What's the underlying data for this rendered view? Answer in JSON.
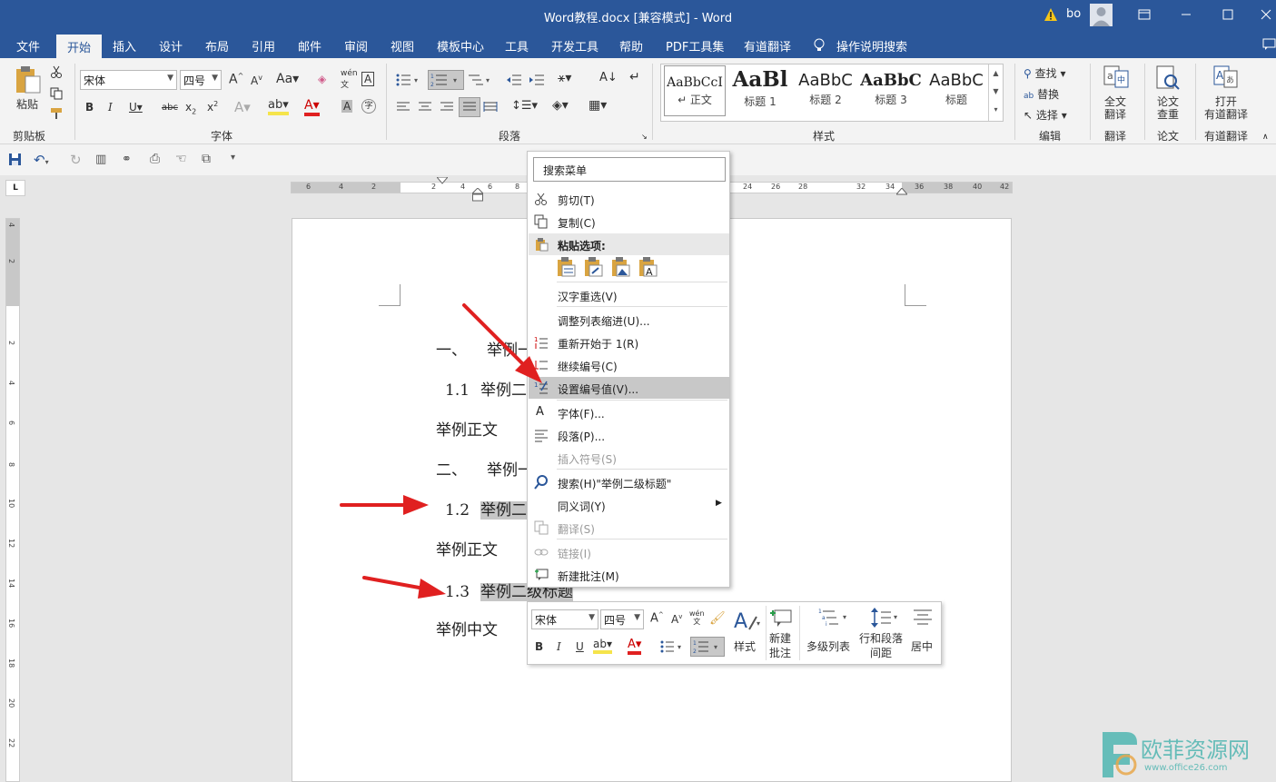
{
  "window": {
    "title": "Word教程.docx [兼容模式]  -  Word",
    "user": "bo"
  },
  "menu_tabs": [
    "文件",
    "开始",
    "插入",
    "设计",
    "布局",
    "引用",
    "邮件",
    "审阅",
    "视图",
    "模板中心",
    "工具",
    "开发工具",
    "帮助",
    "PDF工具集",
    "有道翻译"
  ],
  "tell_me": "操作说明搜索",
  "ribbon": {
    "paste_label": "粘贴",
    "clipboard_label": "剪贴板",
    "font_name": "宋体",
    "font_size": "四号",
    "font_label": "字体",
    "paragraph_label": "段落",
    "styles_label": "样式",
    "styles": [
      {
        "preview": "AaBbCcI",
        "name": "↵ 正文"
      },
      {
        "preview": "AaBl",
        "name": "标题 1"
      },
      {
        "preview": "AaBbC",
        "name": "标题 2"
      },
      {
        "preview": "AaBbC",
        "name": "标题 3"
      },
      {
        "preview": "AaBbC",
        "name": "标题"
      }
    ],
    "find": "查找",
    "replace": "替换",
    "select": "选择",
    "edit_label": "编辑",
    "full_translate": [
      "全文",
      "翻译"
    ],
    "translate_label": "翻译",
    "paper_check": [
      "论文",
      "查重"
    ],
    "paper_label": "论文",
    "open_youdao": [
      "打开",
      "有道翻译"
    ],
    "youdao_label": "有道翻译"
  },
  "ruler_numbers": [
    "6",
    "4",
    "2",
    "2",
    "4",
    "6",
    "8",
    "24",
    "26",
    "28",
    "32",
    "34",
    "36",
    "38",
    "40",
    "42"
  ],
  "vruler_numbers": [
    "4",
    "2",
    "2",
    "4",
    "6",
    "8",
    "10",
    "12",
    "14",
    "16",
    "18",
    "20",
    "22"
  ],
  "document": {
    "lines": [
      {
        "num": "一、",
        "text": "举例一"
      },
      {
        "num": "1.1",
        "text": "举例二"
      },
      {
        "num": "",
        "text": "举例正文"
      },
      {
        "num": "二、",
        "text": "举例一"
      },
      {
        "num": "1.2",
        "text": "举例二"
      },
      {
        "num": "",
        "text": "举例正文"
      },
      {
        "num": "1.3",
        "text": "举例二级标题"
      },
      {
        "num": "",
        "text": "举例中文"
      }
    ]
  },
  "context_menu": {
    "search_placeholder": "搜索菜单",
    "items": [
      {
        "label": "剪切(T)",
        "icon": "scissors-icon"
      },
      {
        "label": "复制(C)",
        "icon": "copy-icon"
      },
      {
        "label": "粘贴选项:",
        "icon": "clipboard-icon"
      },
      {
        "label": "汉字重选(V)",
        "icon": ""
      },
      {
        "label": "调整列表缩进(U)...",
        "icon": ""
      },
      {
        "label": "重新开始于 1(R)",
        "icon": "restart-numbering-icon"
      },
      {
        "label": "继续编号(C)",
        "icon": "continue-numbering-icon"
      },
      {
        "label": "设置编号值(V)...",
        "icon": "set-numbering-value-icon"
      },
      {
        "label": "字体(F)...",
        "icon": "font-icon"
      },
      {
        "label": "段落(P)...",
        "icon": "paragraph-icon"
      },
      {
        "label": "插入符号(S)",
        "icon": ""
      },
      {
        "label": "搜索(H)\"举例二级标题\"",
        "icon": "search-icon"
      },
      {
        "label": "同义词(Y)",
        "icon": ""
      },
      {
        "label": "翻译(S)",
        "icon": "translate-icon"
      },
      {
        "label": "链接(I)",
        "icon": "link-icon"
      },
      {
        "label": "新建批注(M)",
        "icon": "new-comment-icon"
      }
    ]
  },
  "mini_toolbar": {
    "font_name": "宋体",
    "font_size": "四号",
    "styles": "样式",
    "new_comment": [
      "新建",
      "批注"
    ],
    "multilevel": "多级列表",
    "spacing": [
      "行和段落",
      "间距"
    ],
    "center": "居中"
  },
  "watermark": {
    "name": "欧菲资源网",
    "url": "www.office26.com"
  },
  "colors": {
    "accent": "#2b579a",
    "arrow": "#e02020",
    "font_color": "#e02020",
    "highlight": "#f5e44b"
  }
}
